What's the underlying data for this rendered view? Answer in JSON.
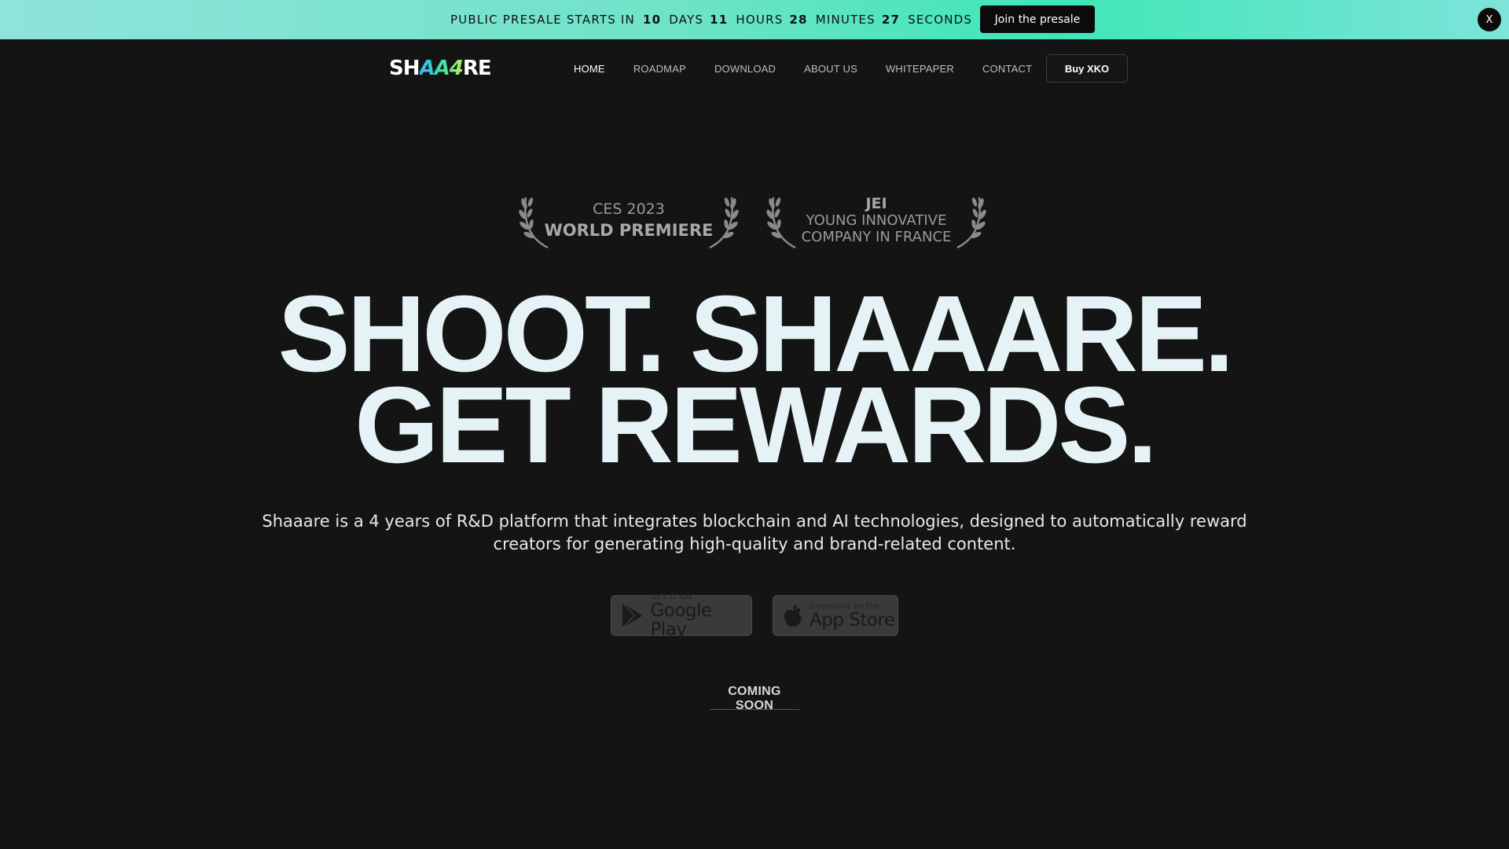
{
  "banner": {
    "prefix": "PUBLIC PRESALE STARTS IN",
    "days_value": "10",
    "days_label": "DAYS",
    "hours_value": "11",
    "hours_label": "HOURS",
    "minutes_value": "28",
    "minutes_label": "MINUTES",
    "seconds_value": "27",
    "seconds_label": "SECONDS",
    "cta_label": "Join the presale",
    "close_label": "X"
  },
  "logo": {
    "left": "SH",
    "middle": "AA4",
    "right": "RE"
  },
  "nav": {
    "items": [
      {
        "label": "HOME"
      },
      {
        "label": "ROADMAP"
      },
      {
        "label": "DOWNLOAD"
      },
      {
        "label": "ABOUT US"
      },
      {
        "label": "WHITEPAPER"
      },
      {
        "label": "CONTACT"
      }
    ],
    "buy_label": "Buy XKO"
  },
  "awards": [
    {
      "line1": "CES 2023",
      "line2": "WORLD PREMIERE"
    },
    {
      "line1": "JEI",
      "line2": "YOUNG INNOVATIVE",
      "line3": "COMPANY IN FRANCE"
    }
  ],
  "hero": {
    "headline_line1": "SHOOT. SHAAARE.",
    "headline_line2": "GET REWARDS.",
    "description": "Shaaare is a 4 years of R&D platform that integrates blockchain and AI technologies, designed to automatically reward creators for generating high-quality and brand-related content."
  },
  "stores": {
    "google_small": "GET IT ON",
    "google_big": "Google Play",
    "apple_small": "Download on the",
    "apple_big": "App Store"
  },
  "coming_soon": "COMING SOON"
}
